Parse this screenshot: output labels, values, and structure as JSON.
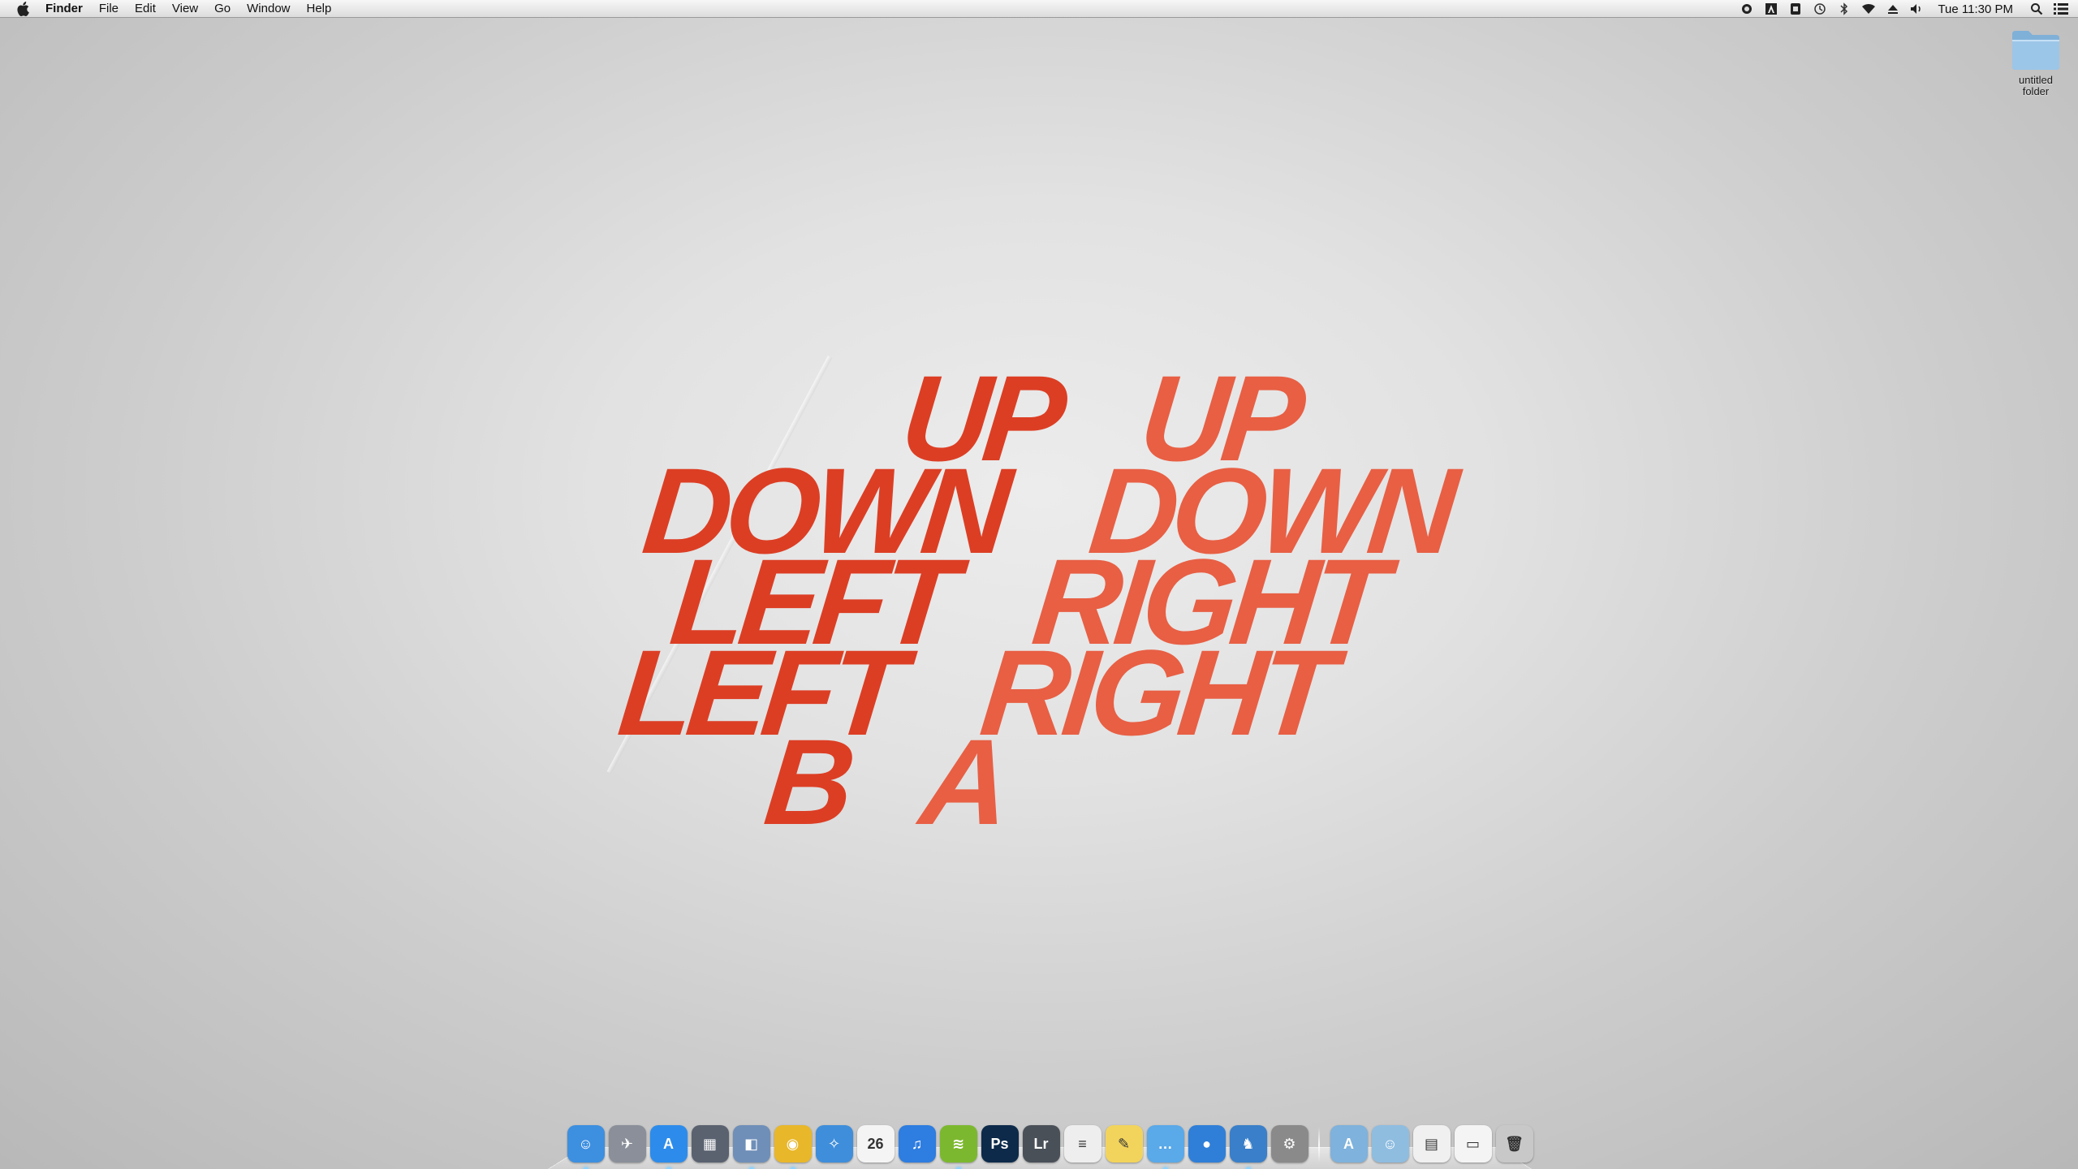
{
  "menubar": {
    "app_name": "Finder",
    "menus": [
      "File",
      "Edit",
      "View",
      "Go",
      "Window",
      "Help"
    ],
    "status_icons": [
      "dropbox-icon",
      "adobe-icon",
      "evernote-icon",
      "time-machine-icon",
      "bluetooth-icon",
      "wifi-icon",
      "eject-icon",
      "volume-icon"
    ],
    "clock": "Tue 11:30 PM"
  },
  "wallpaper": {
    "left_words": [
      "UP",
      "DOWN",
      "LEFT",
      "LEFT",
      "B"
    ],
    "right_words": [
      "UP",
      "DOWN",
      "RIGHT",
      "RIGHT",
      "A"
    ],
    "colors": {
      "left": "#dc3e24",
      "right": "#e85f44"
    }
  },
  "desktop": {
    "folder": {
      "label_line1": "untitled",
      "label_line2": "folder"
    }
  },
  "dock": {
    "apps": [
      {
        "name": "finder",
        "glyph": "☺",
        "color": "#3d8fe0",
        "running": true
      },
      {
        "name": "launchpad",
        "glyph": "✈",
        "color": "#8a8f99",
        "running": false
      },
      {
        "name": "app-store",
        "glyph": "A",
        "color": "#2d8ceb",
        "running": true
      },
      {
        "name": "mission-control",
        "glyph": "▦",
        "color": "#5a6270",
        "running": false
      },
      {
        "name": "preview",
        "glyph": "◧",
        "color": "#6f8fb8",
        "running": true
      },
      {
        "name": "chrome",
        "glyph": "◉",
        "color": "#e8b72a",
        "running": true
      },
      {
        "name": "safari",
        "glyph": "✧",
        "color": "#3f8edb",
        "running": false
      },
      {
        "name": "calendar",
        "glyph": "26",
        "color": "#f4f4f4",
        "running": false
      },
      {
        "name": "itunes",
        "glyph": "♫",
        "color": "#2e7de0",
        "running": false
      },
      {
        "name": "spotify",
        "glyph": "≋",
        "color": "#7cb82f",
        "running": true
      },
      {
        "name": "photoshop",
        "glyph": "Ps",
        "color": "#0d2a4a",
        "running": false
      },
      {
        "name": "lightroom",
        "glyph": "Lr",
        "color": "#4a5058",
        "running": false
      },
      {
        "name": "textedit",
        "glyph": "≡",
        "color": "#eeeeee",
        "running": false
      },
      {
        "name": "stickies",
        "glyph": "✎",
        "color": "#f2d45c",
        "running": false
      },
      {
        "name": "messages",
        "glyph": "…",
        "color": "#5aa9e8",
        "running": true
      },
      {
        "name": "skype",
        "glyph": "●",
        "color": "#2f7fd8",
        "running": false
      },
      {
        "name": "tweetbot",
        "glyph": "♞",
        "color": "#3a7fc9",
        "running": true
      },
      {
        "name": "system-preferences",
        "glyph": "⚙",
        "color": "#8a8a8a",
        "running": false
      }
    ],
    "stacks": [
      {
        "name": "applications-stack",
        "glyph": "A",
        "color": "#7fb2dc"
      },
      {
        "name": "documents-stack",
        "glyph": "☺",
        "color": "#8fbde0"
      },
      {
        "name": "downloads-stack",
        "glyph": "▤",
        "color": "#f0f0f0"
      },
      {
        "name": "preview-stack",
        "glyph": "▭",
        "color": "#f4f4f4"
      }
    ],
    "trash": {
      "name": "trash",
      "glyph": "🗑",
      "color": "#c8c8c8"
    }
  }
}
